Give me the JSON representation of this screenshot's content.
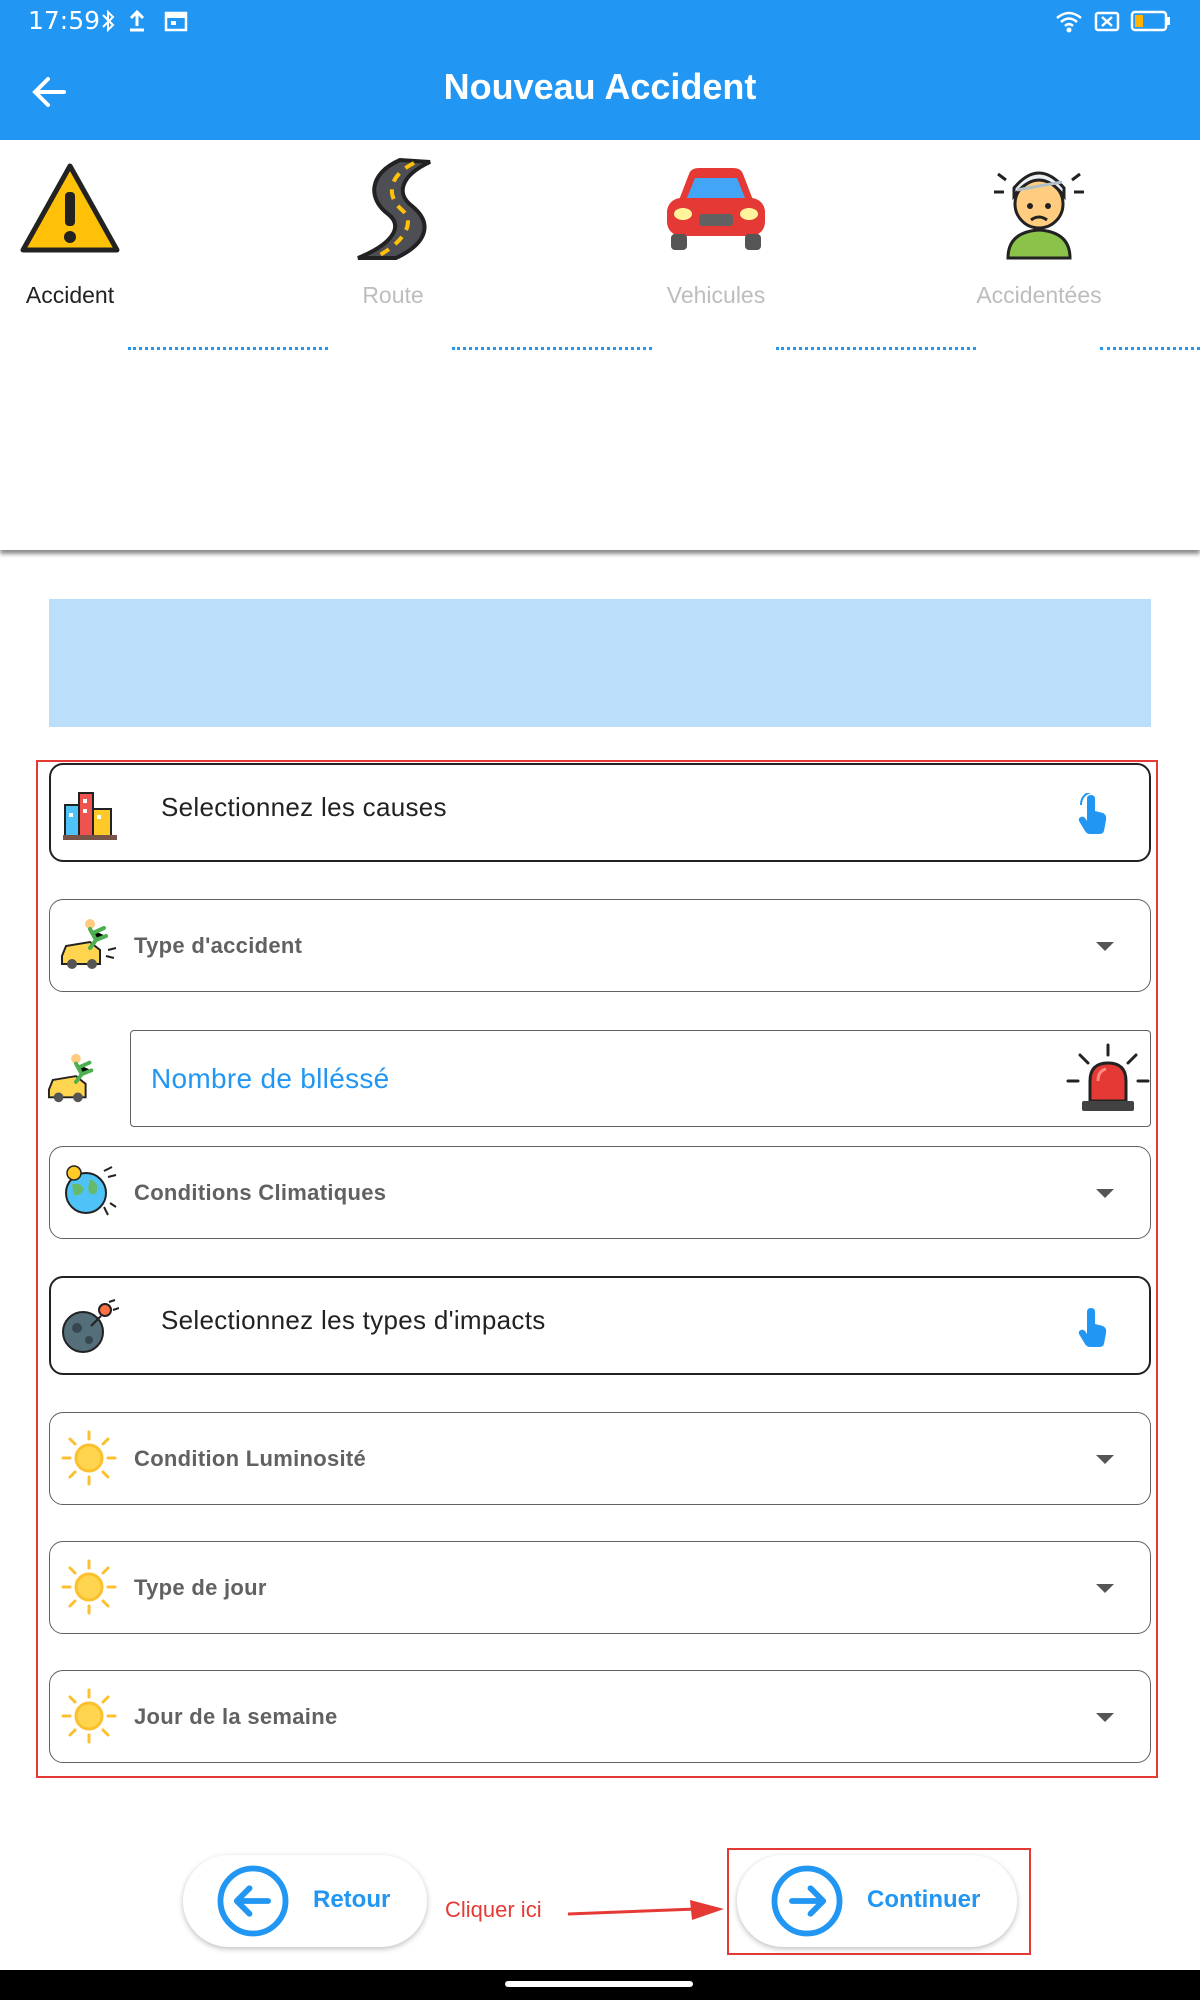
{
  "status_bar": {
    "time": "17:59",
    "left_icons": [
      "bluetooth-icon",
      "upload-icon",
      "calendar-icon"
    ],
    "right_icons": [
      "wifi-icon",
      "sim-x-icon",
      "battery-low-icon"
    ]
  },
  "app_bar": {
    "title": "Nouveau Accident",
    "back_icon": "arrow-left-icon",
    "color": "#2196f3"
  },
  "stepper": {
    "steps": [
      {
        "label": "Accident",
        "icon": "warning-triangle-icon",
        "active": true
      },
      {
        "label": "Route",
        "icon": "road-icon",
        "active": false
      },
      {
        "label": "Vehicules",
        "icon": "car-icon",
        "active": false
      },
      {
        "label": "Accidentées",
        "icon": "injured-person-icon",
        "active": false
      }
    ]
  },
  "form": {
    "causes": {
      "label": "Selectionnez les causes",
      "icon": "city-buildings-icon",
      "action_icon": "tap-hand-icon"
    },
    "type_accident": {
      "label": "Type d'accident",
      "icon": "car-crash-icon"
    },
    "nombre_blesse": {
      "placeholder": "Nombre de blléssé",
      "icon": "car-crash-icon",
      "suffix_icon": "siren-icon"
    },
    "conditions_climatiques": {
      "label": "Conditions Climatiques",
      "icon": "climate-globe-icon"
    },
    "impacts": {
      "label": "Selectionnez les types d'impacts",
      "icon": "meteor-impact-icon",
      "action_icon": "tap-hand-icon"
    },
    "condition_luminosite": {
      "label": "Condition Luminosité",
      "icon": "sun-icon"
    },
    "type_jour": {
      "label": "Type de jour",
      "icon": "sun-icon"
    },
    "jour_semaine": {
      "label": "Jour de la semaine",
      "icon": "sun-icon"
    }
  },
  "actions": {
    "retour": "Retour",
    "hint": "Cliquer ici",
    "continuer": "Continuer"
  },
  "colors": {
    "primary": "#2196f3",
    "banner": "#bbdefb",
    "highlight": "#e53935"
  }
}
